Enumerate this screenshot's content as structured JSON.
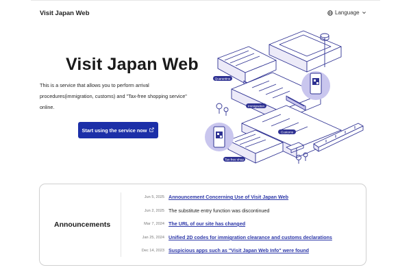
{
  "header": {
    "site_title": "Visit Japan Web",
    "language_label": "Language"
  },
  "hero": {
    "title": "Visit Japan Web",
    "description_line1": "This is a service that allows you to perform arrival",
    "description_line2": "procedures(immigration, customs) and \"Tax-free shopping service\"",
    "description_line3": "online.",
    "cta_label": "Start using the service now"
  },
  "illustration": {
    "labels": [
      "Quarantine",
      "Immigration",
      "Customs",
      "Tax-free shop"
    ]
  },
  "announcements": {
    "heading": "Announcements",
    "items": [
      {
        "date": "Jun 5, 2025",
        "text": "Announcement Concerning Use of Visit Japan Web",
        "link": true
      },
      {
        "date": "Jun 2, 2025",
        "text": "The substitute entry function was discontinued",
        "link": false
      },
      {
        "date": "Mar 7, 2024",
        "text": "The URL of our site has changed",
        "link": true
      },
      {
        "date": "Jan 25, 2024",
        "text": "Unified 2D codes for immigration clearance and customs declarations",
        "link": true
      },
      {
        "date": "Dec 14, 2023",
        "text": "Suspicious apps such as \"Visit Japan Web Info\" were found",
        "link": true
      }
    ]
  },
  "colors": {
    "accent": "#1c2fa8",
    "link": "#2b36a8",
    "illustration": "#2e3192",
    "illustration_fill": "#c9c6ee"
  }
}
